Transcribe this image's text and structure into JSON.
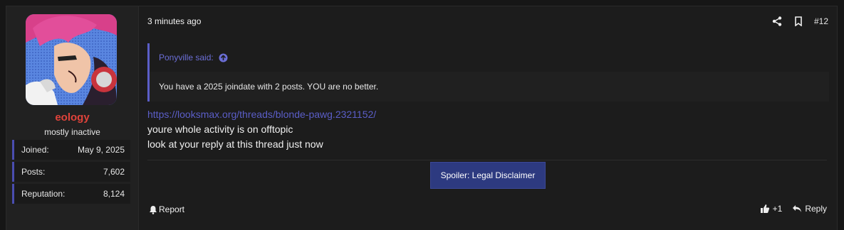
{
  "user": {
    "username": "eology",
    "title": "mostly inactive",
    "stats": [
      {
        "label": "Joined:",
        "value": "May 9, 2025"
      },
      {
        "label": "Posts:",
        "value": "7,602"
      },
      {
        "label": "Reputation:",
        "value": "8,124"
      }
    ],
    "name_color": "#e0433b"
  },
  "post": {
    "time": "3 minutes ago",
    "number": "#12",
    "quote": {
      "author": "Ponyville said:",
      "text": "You have a 2025 joindate with 2 posts. YOU are no better."
    },
    "link": "https://looksmax.org/threads/blonde-pawg.2321152/",
    "lines": [
      "youre whole activity is on offtopic",
      "look at your reply at this thread just now"
    ],
    "spoiler_label": "Spoiler: Legal Disclaimer",
    "accent": "#5b5ec8"
  },
  "footer": {
    "report_label": "Report",
    "like_count": "+1",
    "reply_label": "Reply"
  },
  "icons": {
    "share": "share-icon",
    "bookmark": "bookmark-icon",
    "bell": "bell-icon",
    "thumbs_up": "thumbs-up-icon",
    "reply": "reply-icon",
    "quote_jump": "arrow-up-circle-icon"
  }
}
